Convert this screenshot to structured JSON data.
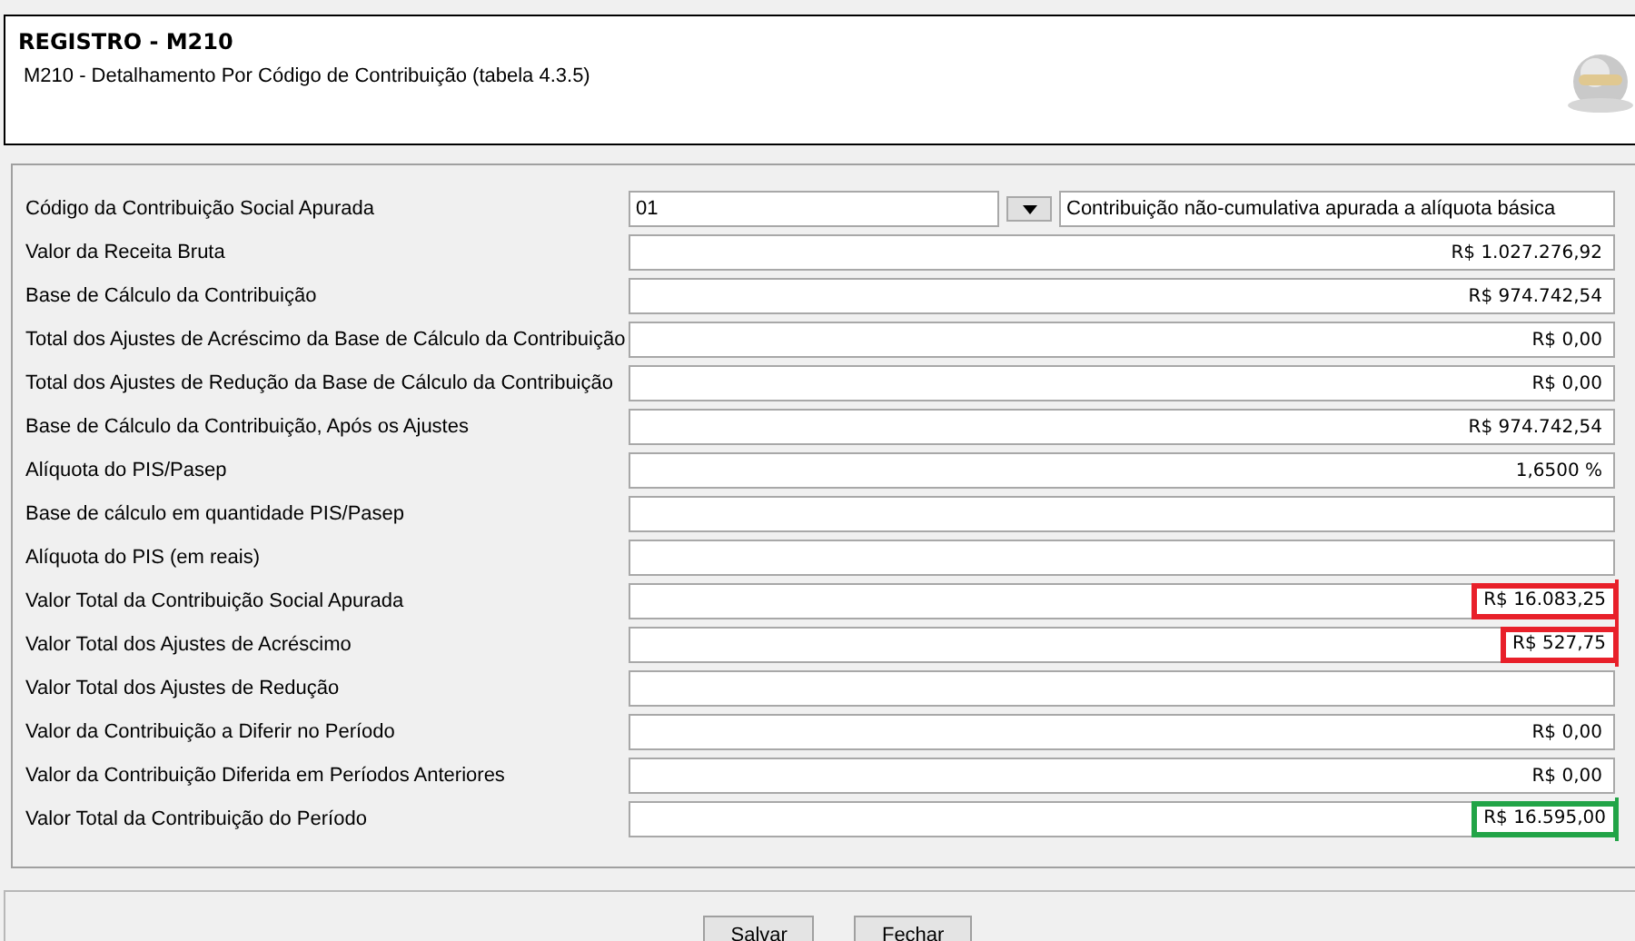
{
  "header": {
    "title": "REGISTRO - M210",
    "subtitle": "M210 - Detalhamento Por Código de Contribuição (tabela 4.3.5)"
  },
  "code_row": {
    "label": "Código da Contribuição Social Apurada",
    "value": "01",
    "description": "Contribuição não-cumulativa apurada a alíquota básica"
  },
  "rows": [
    {
      "label": "Valor da Receita Bruta",
      "value": "R$ 1.027.276,92"
    },
    {
      "label": "Base de Cálculo da Contribuição",
      "value": "R$ 974.742,54"
    },
    {
      "label": "Total dos Ajustes de Acréscimo da Base de Cálculo da Contribuição",
      "value": "R$ 0,00"
    },
    {
      "label": "Total dos Ajustes de Redução da Base de Cálculo da Contribuição",
      "value": "R$ 0,00"
    },
    {
      "label": "Base de Cálculo da Contribuição, Após os Ajustes",
      "value": "R$ 974.742,54"
    },
    {
      "label": "Alíquota do PIS/Pasep",
      "value": "1,6500 %"
    },
    {
      "label": "Base de cálculo em quantidade PIS/Pasep"
    },
    {
      "label": "Alíquota do PIS (em reais)"
    },
    {
      "label": "Valor Total da Contribuição Social Apurada",
      "value": "R$ 16.083,25",
      "color": "#e8202a"
    },
    {
      "label": "Valor Total dos Ajustes de Acréscimo",
      "value": "R$ 527,75",
      "color": "#e8202a"
    },
    {
      "label": "Valor Total dos Ajustes de Redução"
    },
    {
      "label": "Valor da Contribuição a Diferir no Período",
      "value": "R$ 0,00"
    },
    {
      "label": "Valor da Contribuição Diferida em Períodos Anteriores",
      "value": "R$ 0,00"
    },
    {
      "label": "Valor Total da Contribuição do Período",
      "value": "R$ 16.595,00",
      "color": "#22a447"
    }
  ],
  "buttons": [
    "Salvar",
    "Fechar"
  ]
}
